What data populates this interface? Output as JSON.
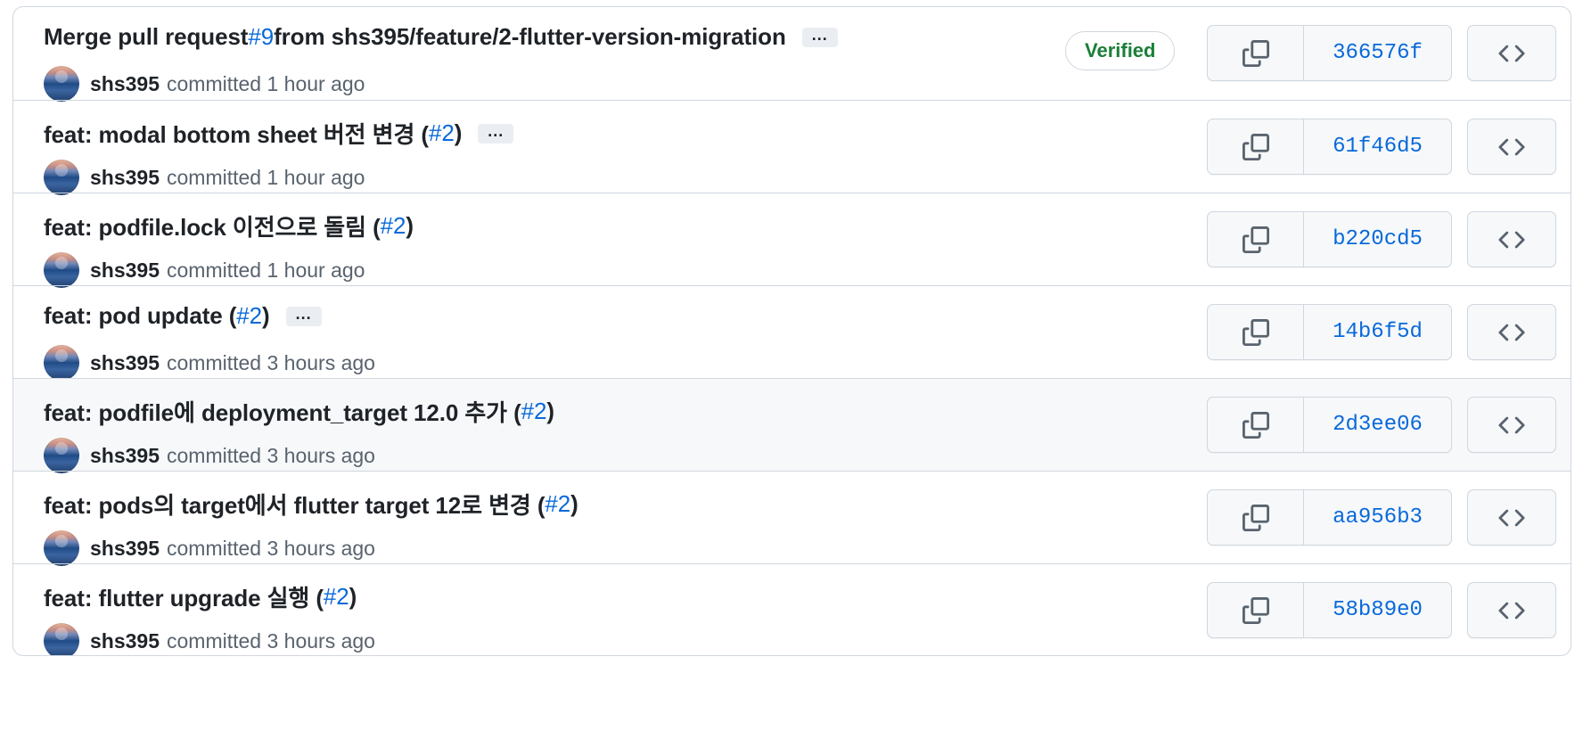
{
  "commits": [
    {
      "title_before": "Merge pull request ",
      "pr": "#9",
      "title_after": " from shs395/feature/2-flutter-version-migration",
      "has_ellipsis": true,
      "verified": "Verified",
      "author": "shs395",
      "committed": "committed 1 hour ago",
      "sha": "366576f",
      "highlighted": false
    },
    {
      "title_before": "feat: modal bottom sheet 버전 변경 (",
      "pr": "#2",
      "title_after": ")",
      "has_ellipsis": true,
      "verified": "",
      "author": "shs395",
      "committed": "committed 1 hour ago",
      "sha": "61f46d5",
      "highlighted": false
    },
    {
      "title_before": "feat: podfile.lock 이전으로 돌림 (",
      "pr": "#2",
      "title_after": ")",
      "has_ellipsis": false,
      "verified": "",
      "author": "shs395",
      "committed": "committed 1 hour ago",
      "sha": "b220cd5",
      "highlighted": false
    },
    {
      "title_before": "feat: pod update (",
      "pr": "#2",
      "title_after": ")",
      "has_ellipsis": true,
      "verified": "",
      "author": "shs395",
      "committed": "committed 3 hours ago",
      "sha": "14b6f5d",
      "highlighted": false
    },
    {
      "title_before": "feat: podfile에 deployment_target 12.0 추가 (",
      "pr": "#2",
      "title_after": ")",
      "has_ellipsis": false,
      "verified": "",
      "author": "shs395",
      "committed": "committed 3 hours ago",
      "sha": "2d3ee06",
      "highlighted": true
    },
    {
      "title_before": "feat: pods의 target에서 flutter target 12로 변경 (",
      "pr": "#2",
      "title_after": ")",
      "has_ellipsis": false,
      "verified": "",
      "author": "shs395",
      "committed": "committed 3 hours ago",
      "sha": "aa956b3",
      "highlighted": false
    },
    {
      "title_before": "feat: flutter upgrade 실행 (",
      "pr": "#2",
      "title_after": ")",
      "has_ellipsis": false,
      "verified": "",
      "author": "shs395",
      "committed": "committed 3 hours ago",
      "sha": "58b89e0",
      "highlighted": false
    }
  ],
  "icons": {
    "copy": "copy-icon",
    "code": "code-icon",
    "ellipsis": "..."
  },
  "colors": {
    "link": "#0969da",
    "verified": "#1a7f37",
    "border": "#d0d7de",
    "muted": "#59636e",
    "highlight_bg": "#f6f8fa"
  }
}
